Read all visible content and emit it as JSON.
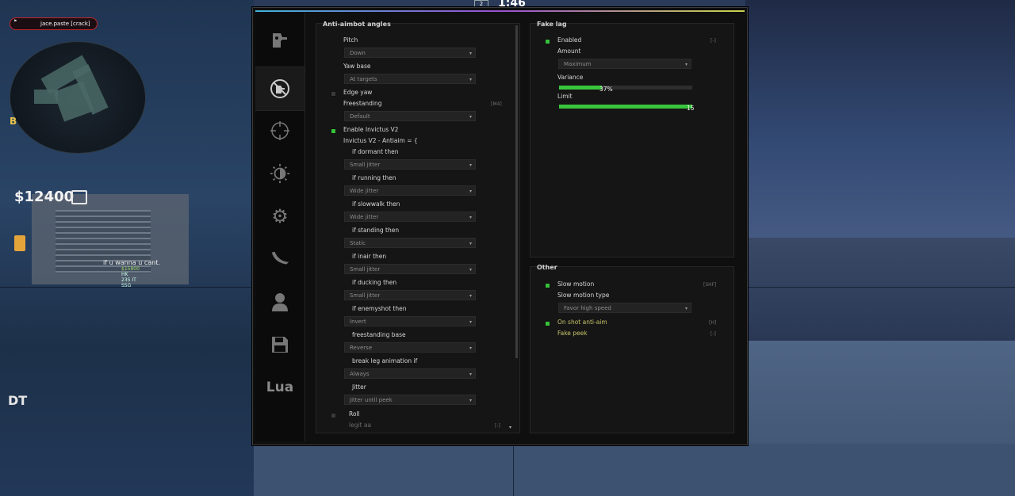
{
  "hud": {
    "player_name": "jace.paste [crack]",
    "money": "$12400",
    "bombsite": "B",
    "timer": "1:46",
    "ct_count": "2",
    "chat_line": "if u wanna u cant.",
    "stat_1": "$15800",
    "stat_2": "HK",
    "stat_3": "235 IT",
    "stat_4": "SSG",
    "dt_label": "DT"
  },
  "sidebar": {
    "tabs": [
      {
        "icon": "rage-head-icon"
      },
      {
        "icon": "anti-aim-icon"
      },
      {
        "icon": "crosshair-icon"
      },
      {
        "icon": "visuals-sun-icon"
      },
      {
        "icon": "misc-gears-icon"
      },
      {
        "icon": "knife-skins-icon"
      },
      {
        "icon": "players-icon"
      },
      {
        "icon": "config-save-icon"
      },
      {
        "label": "Lua"
      }
    ]
  },
  "antiaim": {
    "title": "Anti-aimbot angles",
    "pitch_label": "Pitch",
    "pitch_value": "Down",
    "yaw_base_label": "Yaw base",
    "yaw_base_value": "At targets",
    "edge_yaw_label": "Edge yaw",
    "freestanding_label": "Freestanding",
    "freestanding_key": "[M4]",
    "freestanding_value": "Default",
    "enable_invictus_label": "Enable Invictus V2",
    "invictus_header": "Invictus V2 - Antiaim = {",
    "conditions": [
      {
        "label": "if dormant then",
        "value": "Small jitter"
      },
      {
        "label": "if running then",
        "value": "Wide jitter"
      },
      {
        "label": "if slowwalk then",
        "value": "Wide jitter"
      },
      {
        "label": "if standing then",
        "value": "Static"
      },
      {
        "label": "if inair then",
        "value": "Small jitter"
      },
      {
        "label": "if ducking then",
        "value": "Small jitter"
      },
      {
        "label": "if enemyshot then",
        "value": "Invert"
      },
      {
        "label": "freestanding base",
        "value": "Reverse"
      },
      {
        "label": "break leg animation if",
        "value": "Always"
      },
      {
        "label": "Jitter",
        "value": "Jitter until peek"
      }
    ],
    "roll_label": "Roll",
    "legit_aa_label": "legit aa",
    "legit_aa_key": "[-]"
  },
  "fakelag": {
    "title": "Fake lag",
    "enabled_label": "Enabled",
    "enabled_key": "[-]",
    "amount_label": "Amount",
    "amount_value": "Maximum",
    "variance_label": "Variance",
    "variance_value": "37%",
    "variance_fraction": 0.32,
    "limit_label": "Limit",
    "limit_value": "15",
    "limit_fraction": 1.0
  },
  "other": {
    "title": "Other",
    "slow_motion_label": "Slow motion",
    "slow_motion_key": "[SHF]",
    "slow_motion_type_label": "Slow motion type",
    "slow_motion_type_value": "Favor high speed",
    "on_shot_label": "On shot anti-aim",
    "on_shot_key": "[H]",
    "fake_peek_label": "Fake peek",
    "fake_peek_key": "[-]"
  },
  "colors": {
    "accent_green": "#39c53c",
    "label_yellow": "#c8c36a",
    "menu_bg": "#0f0f0f",
    "panel_bg": "#151515"
  }
}
